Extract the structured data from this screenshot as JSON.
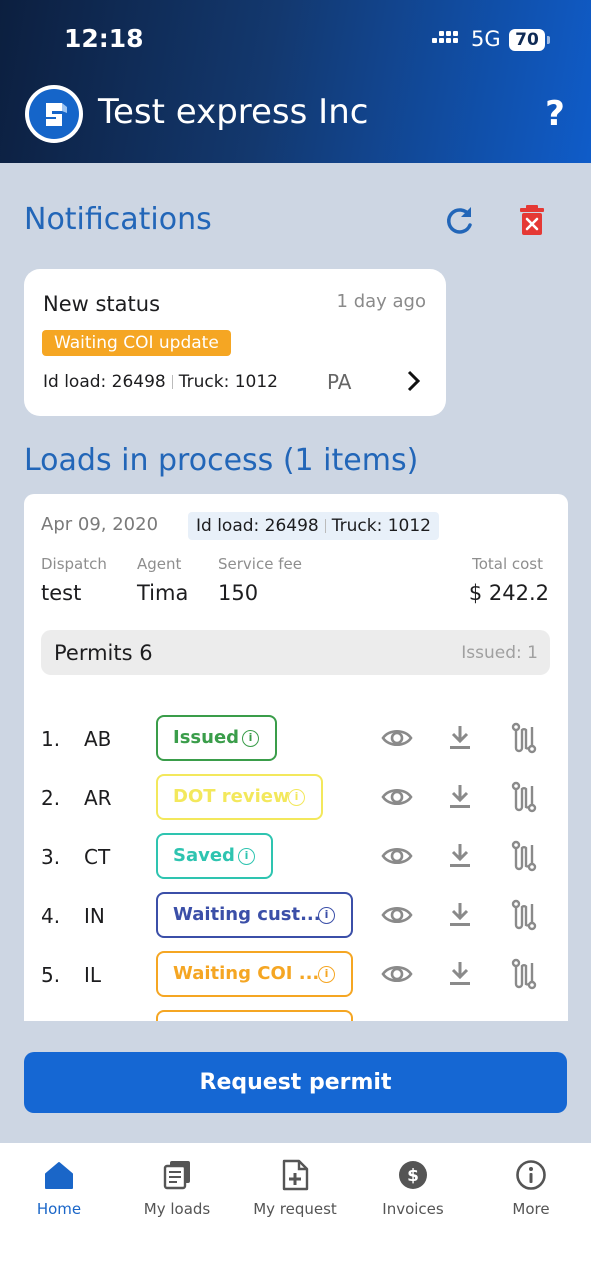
{
  "status_bar": {
    "time": "12:18",
    "network": "5G",
    "battery": "70"
  },
  "header": {
    "title": "Test express Inc",
    "help_label": "?"
  },
  "notifications": {
    "title": "Notifications",
    "items": [
      {
        "title": "New status",
        "time": "1 day ago",
        "badge": "Waiting COI update",
        "id_load": "Id load: 26498",
        "truck": "Truck: 1012",
        "state": "PA"
      }
    ]
  },
  "loads": {
    "title": "Loads in process (1 items)",
    "card": {
      "date": "Apr 09, 2020",
      "id_load": "Id load: 26498",
      "truck": "Truck: 1012",
      "labels": {
        "dispatch": "Dispatch",
        "agent": "Agent",
        "service_fee": "Service fee",
        "total_cost": "Total cost"
      },
      "values": {
        "dispatch": "test",
        "agent": "Tima",
        "service_fee": "150",
        "total_cost": "$ 242.2"
      },
      "permits_title": "Permits 6",
      "permits_issued": "Issued: 1",
      "permits": [
        {
          "num": "1.",
          "state": "AB",
          "status": "Issued",
          "color": "#3a9d4a"
        },
        {
          "num": "2.",
          "state": "AR",
          "status": "DOT review",
          "color": "#f3e85c"
        },
        {
          "num": "3.",
          "state": "CT",
          "status": "Saved",
          "color": "#2ec4b0"
        },
        {
          "num": "4.",
          "state": "IN",
          "status": "Waiting cust...",
          "color": "#3b4fa8"
        },
        {
          "num": "5.",
          "state": "IL",
          "status": "Waiting COI ...",
          "color": "#f5a623"
        }
      ]
    }
  },
  "request_button": "Request permit",
  "tabs": [
    {
      "label": "Home",
      "icon": "home-icon"
    },
    {
      "label": "My loads",
      "icon": "loads-icon"
    },
    {
      "label": "My request",
      "icon": "request-icon"
    },
    {
      "label": "Invoices",
      "icon": "dollar-icon"
    },
    {
      "label": "More",
      "icon": "info-icon"
    }
  ],
  "colors": {
    "brand": "#1567d3",
    "title_blue": "#2266b8",
    "badge_orange": "#f5a623",
    "trash_red": "#e53935"
  }
}
